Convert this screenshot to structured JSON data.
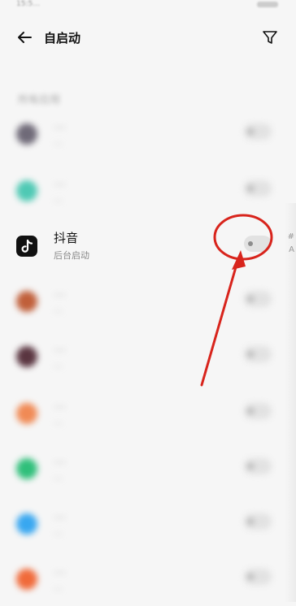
{
  "status_bar": {
    "time": "15:5…",
    "right": "…"
  },
  "header": {
    "title": "自启动"
  },
  "section_title": "所有应用",
  "apps": [
    {
      "name": "…",
      "sub": "…",
      "icon_color": "#6f6a78",
      "blurred": true,
      "enabled": false
    },
    {
      "name": "…",
      "sub": "…",
      "icon_color": "#4fc9b4",
      "blurred": true,
      "enabled": false
    },
    {
      "name": "抖音",
      "sub": "后台启动",
      "icon_color": "#111111",
      "blurred": false,
      "enabled": false
    },
    {
      "name": "…",
      "sub": "…",
      "icon_color": "#c05f3a",
      "blurred": true,
      "enabled": false
    },
    {
      "name": "…",
      "sub": "…",
      "icon_color": "#5a3540",
      "blurred": true,
      "enabled": false
    },
    {
      "name": "…",
      "sub": "…",
      "icon_color": "#f08a55",
      "blurred": true,
      "enabled": false
    },
    {
      "name": "…",
      "sub": "…",
      "icon_color": "#2fbf7a",
      "blurred": true,
      "enabled": false
    },
    {
      "name": "…",
      "sub": "…",
      "icon_color": "#38a7f0",
      "blurred": true,
      "enabled": false
    },
    {
      "name": "…",
      "sub": "…",
      "icon_color": "#f06a3a",
      "blurred": true,
      "enabled": false
    }
  ],
  "edge_chars": [
    "#",
    "A"
  ],
  "annotation": {
    "color": "#d8241c"
  }
}
